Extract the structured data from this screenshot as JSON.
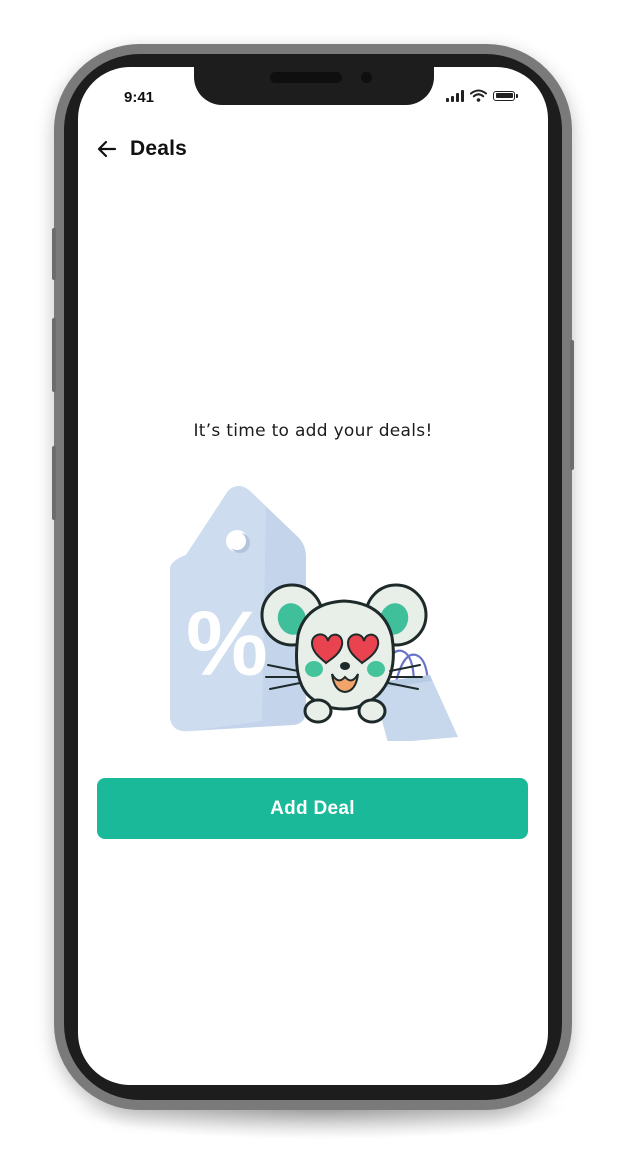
{
  "status_bar": {
    "time": "9:41",
    "signal_icon": "cellular-signal-icon",
    "wifi_icon": "wifi-icon",
    "battery_icon": "battery-icon"
  },
  "header": {
    "back_icon": "arrow-left-icon",
    "title": "Deals"
  },
  "empty_state": {
    "message": "It’s time to add your deals!",
    "illustration_icons": [
      "price-tag-icon",
      "mouse-mascot-icon",
      "shopping-bag-icon"
    ],
    "tag_glyph": "%"
  },
  "actions": {
    "add_deal_label": "Add Deal"
  },
  "colors": {
    "accent": "#1ab99a",
    "tag": "#cad9ec",
    "mascot_body": "#e8efe9",
    "mascot_ear": "#3fbf9a",
    "heart": "#e8434f",
    "phone_frame": "#7a7a7a",
    "bezel": "#1d1d1d"
  }
}
